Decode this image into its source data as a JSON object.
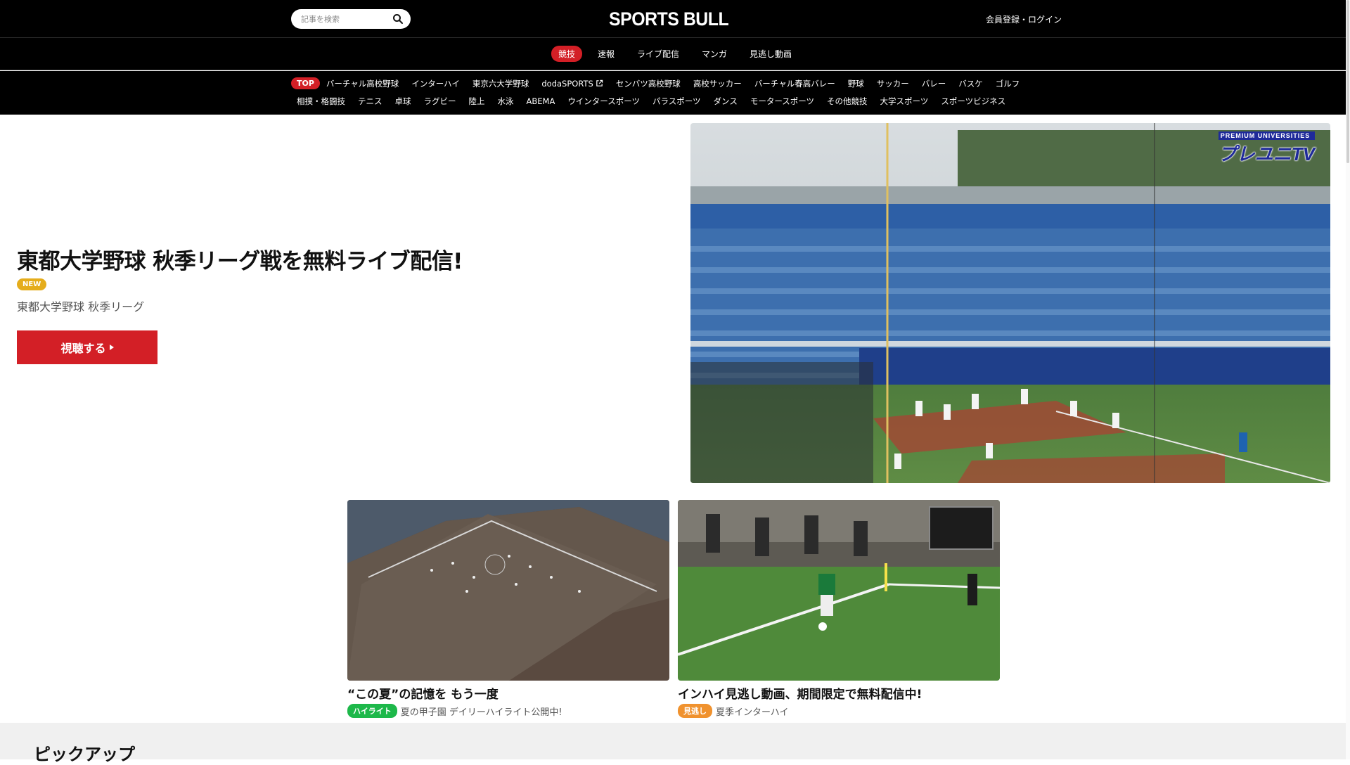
{
  "header": {
    "search_placeholder": "記事を検索",
    "logo": "SPORTS BULL",
    "login": "会員登録・ログイン"
  },
  "category_nav": [
    {
      "label": "競技",
      "active": true
    },
    {
      "label": "速報",
      "active": false
    },
    {
      "label": "ライブ配信",
      "active": false
    },
    {
      "label": "マンガ",
      "active": false
    },
    {
      "label": "見逃し動画",
      "active": false
    }
  ],
  "sport_nav": {
    "top_badge": "TOP",
    "row1": [
      "バーチャル高校野球",
      "インターハイ",
      "東京六大学野球",
      "dodaSPORTS",
      "センバツ高校野球",
      "高校サッカー",
      "バーチャル春高バレー",
      "野球",
      "サッカー",
      "バレー",
      "バスケ",
      "ゴルフ"
    ],
    "row2": [
      "相撲・格闘技",
      "テニス",
      "卓球",
      "ラグビー",
      "陸上",
      "水泳",
      "ABEMA",
      "ウインタースポーツ",
      "パラスポーツ",
      "ダンス",
      "モータースポーツ",
      "その他競技",
      "大学スポーツ",
      "スポーツビジネス"
    ]
  },
  "hero": {
    "title": "東都大学野球 秋季リーグ戦を無料ライブ配信!",
    "badge": "NEW",
    "subtitle": "東都大学野球 秋季リーグ",
    "button": "視聴する",
    "image_logo": "プレユニTV",
    "image_logo_small": "PREMIUM UNIVERSITIES"
  },
  "cards": [
    {
      "title": "“この夏”の記憶を もう一度",
      "tag": "ハイライト",
      "tag_color": "#1db84a",
      "meta": "夏の甲子園 デイリーハイライト公開中!"
    },
    {
      "title": "インハイ見逃し動画、期間限定で無料配信中!",
      "tag": "見逃し",
      "tag_color": "#f0922e",
      "meta": "夏季インターハイ"
    }
  ],
  "pickup": {
    "heading": "ピックアップ"
  },
  "colors": {
    "accent": "#d31f26",
    "header_bg": "#000000",
    "new_badge": "#e5ad1c"
  }
}
